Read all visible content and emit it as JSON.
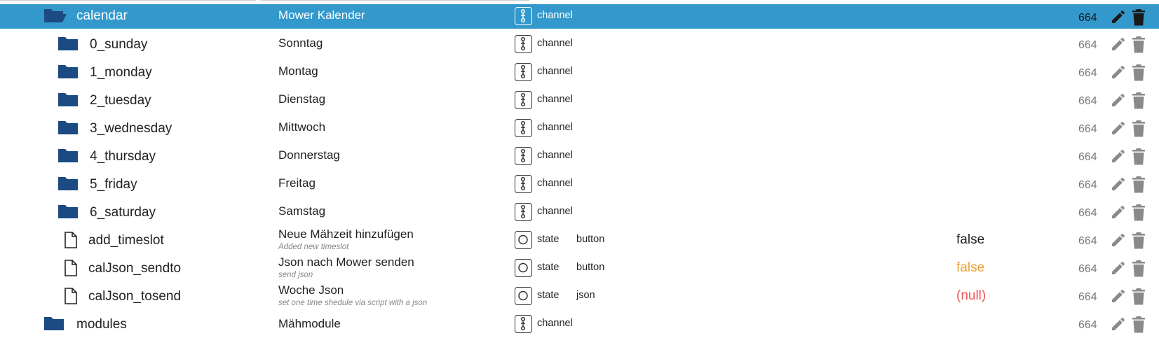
{
  "rows": [
    {
      "name": "calendar",
      "label": "Mower Kalender",
      "desc": "",
      "type": "channel",
      "role": "",
      "value": "",
      "acl": "664",
      "icon": "folder-open-icon"
    },
    {
      "name": "0_sunday",
      "label": "Sonntag",
      "desc": "",
      "type": "channel",
      "role": "",
      "value": "",
      "acl": "664",
      "icon": "folder-icon"
    },
    {
      "name": "1_monday",
      "label": "Montag",
      "desc": "",
      "type": "channel",
      "role": "",
      "value": "",
      "acl": "664",
      "icon": "folder-icon"
    },
    {
      "name": "2_tuesday",
      "label": "Dienstag",
      "desc": "",
      "type": "channel",
      "role": "",
      "value": "",
      "acl": "664",
      "icon": "folder-icon"
    },
    {
      "name": "3_wednesday",
      "label": "Mittwoch",
      "desc": "",
      "type": "channel",
      "role": "",
      "value": "",
      "acl": "664",
      "icon": "folder-icon"
    },
    {
      "name": "4_thursday",
      "label": "Donnerstag",
      "desc": "",
      "type": "channel",
      "role": "",
      "value": "",
      "acl": "664",
      "icon": "folder-icon"
    },
    {
      "name": "5_friday",
      "label": "Freitag",
      "desc": "",
      "type": "channel",
      "role": "",
      "value": "",
      "acl": "664",
      "icon": "folder-icon"
    },
    {
      "name": "6_saturday",
      "label": "Samstag",
      "desc": "",
      "type": "channel",
      "role": "",
      "value": "",
      "acl": "664",
      "icon": "folder-icon"
    },
    {
      "name": "add_timeslot",
      "label": "Neue Mähzeit hinzufügen",
      "desc": "Added new timeslot",
      "type": "state",
      "role": "button",
      "value": "false",
      "acl": "664",
      "icon": "file-icon"
    },
    {
      "name": "calJson_sendto",
      "label": "Json nach Mower senden",
      "desc": "send json",
      "type": "state",
      "role": "button",
      "value": "false",
      "acl": "664",
      "icon": "file-icon"
    },
    {
      "name": "calJson_tosend",
      "label": "Woche Json",
      "desc": "set one time shedule via script with a json",
      "type": "state",
      "role": "json",
      "value": "(null)",
      "acl": "664",
      "icon": "file-icon"
    },
    {
      "name": "modules",
      "label": "Mähmodule",
      "desc": "",
      "type": "channel",
      "role": "",
      "value": "",
      "acl": "664",
      "icon": "folder-icon"
    }
  ],
  "colors": {
    "selected_bg": "#3399cc",
    "folder": "#1c4a82",
    "false_orange": "#f0a030",
    "null_red": "#ee5555"
  }
}
